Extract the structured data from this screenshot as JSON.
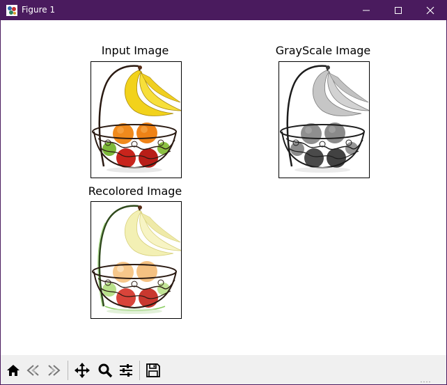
{
  "window": {
    "title": "Figure 1",
    "icon": "matplotlib-figure-icon",
    "controls": [
      "minimize-icon",
      "maximize-icon",
      "close-icon"
    ]
  },
  "figure": {
    "subplots": [
      {
        "title": "Input Image",
        "image": "fruit-basket-color"
      },
      {
        "title": "GrayScale Image",
        "image": "fruit-basket-grayscale"
      },
      {
        "title": "Recolored Image",
        "image": "fruit-basket-recolored"
      }
    ]
  },
  "toolbar": {
    "buttons": [
      "home-icon",
      "back-icon",
      "forward-icon",
      "pan-icon",
      "zoom-icon",
      "configure-subplots-icon",
      "save-icon"
    ]
  },
  "colors": {
    "titlebar": "#4a1b5e",
    "toolbar": "#f0f0f0"
  }
}
